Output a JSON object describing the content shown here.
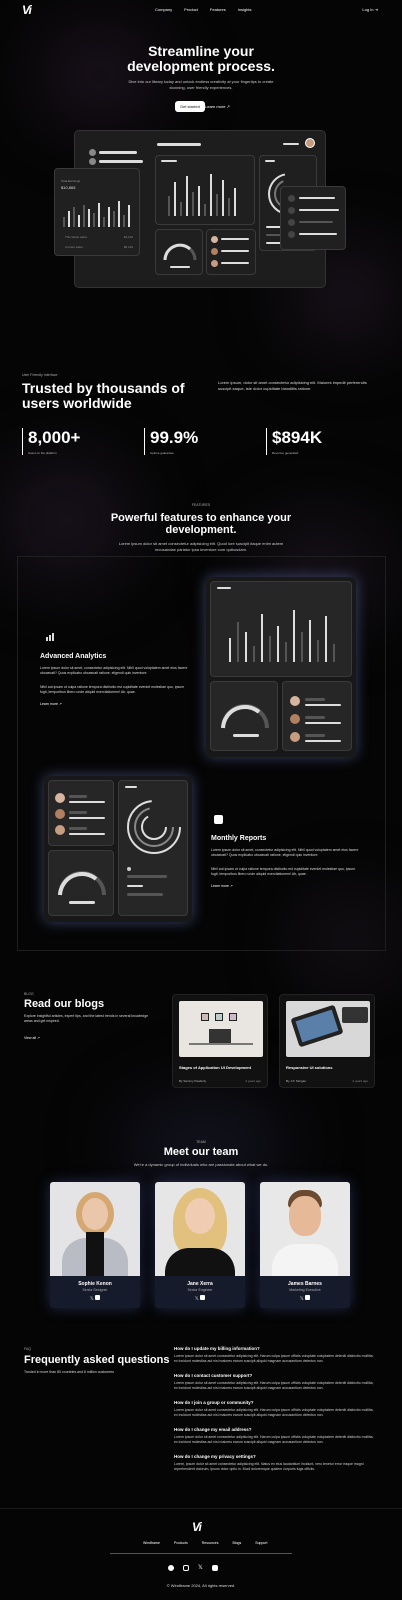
{
  "brand": {
    "logo": "Vi",
    "footer_logo": "Vi"
  },
  "nav": {
    "links": [
      "Company",
      "Product",
      "Features",
      "Insights"
    ],
    "login": "Log In ⇥"
  },
  "hero": {
    "title_line1": "Streamline your",
    "title_line2": "development process.",
    "subtitle_line1": "Dive into our library today and unlock endless creativity at your fingertips to create",
    "subtitle_line2": "stunning, user friendly experiences.",
    "primary_button": "Get started",
    "secondary_button": "Learn more ↗",
    "mini_card": {
      "label": "Total Earnings",
      "value": "$10,865",
      "row1_label": "This Week sales",
      "row1_value": "$4,210",
      "row2_label": "Current sales",
      "row2_value": "$6,120"
    }
  },
  "trusted": {
    "kicker": "User Friendly Interface",
    "title_line1": "Trusted by thousands of",
    "title_line2": "users worldwide",
    "body": "Lorem ipsum, dolor sit amet consectetur adipisicing elit. Maiores impedit perferendis suscipit eaque, iste dolor cupiditate blanditiis ratione.",
    "stats": [
      {
        "value": "8,000+",
        "label": "Users on the platform"
      },
      {
        "value": "99.9%",
        "label": "Uptime guarantee"
      },
      {
        "value": "$894K",
        "label": "Revenue generated"
      }
    ]
  },
  "features": {
    "kicker": "FEATURES",
    "title_line1": "Powerful features to enhance your",
    "title_line2": "development.",
    "subtitle": "Lorem ipsum dolor sit amet consectetur adipisicing elit. Quod iure suscipit itaque enim autem recusandae pariatur ipsa inventore cum quibusdam.",
    "analytics": {
      "title": "Advanced Analytics",
      "p1": "Lorem ipsum dolor sit amet, consectetur adipisicing elit. Nihil quod voluptatem amet eius facere obcaecati? Quos explicabo obcaecati ratione, eligendi quis inventore.",
      "p2": "Nihil aut ipsam ut culpa ratione tempora distinctio est cupiditate eveniet molestiae quo, ipsum fugit, temporibus libero unde aliquid exercitationem! Ab, quae.",
      "link": "Learn more ↗"
    },
    "reports": {
      "title": "Monthly Reports",
      "p1": "Lorem ipsum dolor sit amet, consectetur adipisicing elit. Nihil quod voluptatem amet eius facere obcaecati? Quos explicabo obcaecati ratione, eligendi quis inventore.",
      "p2": "Nihil aut ipsam ut culpa ratione tempora distinctio est cupiditate eveniet molestiae quo, ipsum fugit, temporibus libero unde aliquid exercitationem! Ab, quae.",
      "link": "Learn more ↗"
    }
  },
  "blogs": {
    "kicker": "BLOG",
    "title": "Read our blogs",
    "subtitle": "Explore insightful articles, expert tips, and the latest trends in several knowledge areas and get inspired.",
    "link": "View all ↗",
    "posts": [
      {
        "title": "Stages of Application UI Development",
        "author": "By Sammy Paudurly",
        "time": "2 years ago"
      },
      {
        "title": "Responsive UI solutions",
        "author": "By J.P. Morgan",
        "time": "2 years ago"
      }
    ]
  },
  "team": {
    "kicker": "TEAM",
    "title": "Meet our team",
    "subtitle": "We're a dynamic group of individuals who are passionate about what we do.",
    "members": [
      {
        "name": "Sophie Kenon",
        "role": "Senior Designer"
      },
      {
        "name": "Jane Xerra",
        "role": "Senior Engineer"
      },
      {
        "name": "James Barnes",
        "role": "Marketing Executive"
      }
    ]
  },
  "faq": {
    "kicker": "FAQ",
    "title": "Frequently asked questions",
    "subtitle": "Trusted in more than 80 countries and 6 million customers",
    "items": [
      {
        "q": "How do I update my billing information?",
        "a": "Lorem ipsum dolor sit amet consectetur adipisicing elit. Harum culpa ipsum officiis voluptate voluptatem deleniti distinctio mollitia, ex incidunt molestias aut nisi maiores earum suscipit aliquid magnam accusantium delectus non."
      },
      {
        "q": "How do I contact customer support?",
        "a": "Lorem ipsum dolor sit amet consectetur adipisicing elit. Harum culpa ipsum officiis voluptate voluptatem deleniti distinctio mollitia, ex incidunt molestias aut nisi maiores earum suscipit aliquid magnam accusantium delectus non."
      },
      {
        "q": "How do I join a group or community?",
        "a": "Lorem ipsum dolor sit amet consectetur adipisicing elit. Harum culpa ipsum officiis voluptate voluptatem deleniti distinctio mollitia, ex incidunt molestias aut nisi maiores earum suscipit aliquid magnam accusantium delectus non."
      },
      {
        "q": "How do I change my email address?",
        "a": "Lorem ipsum dolor sit amet consectetur adipisicing elit. Harum culpa ipsum officiis voluptate voluptatem deleniti distinctio mollitia, ex incidunt molestias aut nisi maiores earum suscipit aliquid magnam accusantium delectus non."
      },
      {
        "q": "How do I change my privacy settings?",
        "a": "Lorem, ipsum dolor sit amet consectetur adipisicing elit. Natus ex eius laudantium incidunt, vero tenetur error eaque magni reprehenderit dolorum, ipsum dolor optio in. Modi doloremque quidem corporis fuga officiis."
      }
    ]
  },
  "footer": {
    "links": [
      "Windframe",
      "Products",
      "Resources",
      "Blogs",
      "Support"
    ],
    "social_icons": [
      "facebook-icon",
      "instagram-icon",
      "x-icon",
      "youtube-icon"
    ],
    "copyright": "© Windframe 2024, All rights reserved."
  },
  "colors": {
    "background": "#050505",
    "glow": "#3a2a3f",
    "panel": "#262626",
    "accent_glow": "#6f86dd"
  }
}
